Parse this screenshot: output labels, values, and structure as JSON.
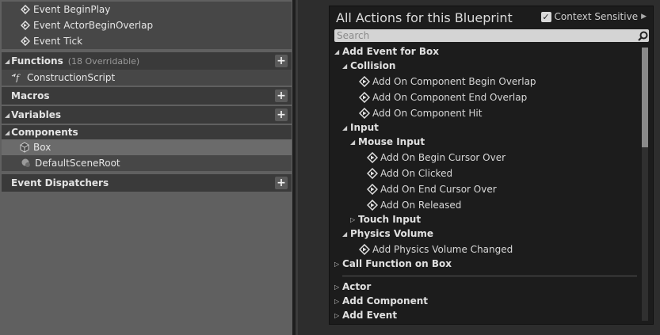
{
  "left_panel": {
    "events": [
      "Event BeginPlay",
      "Event ActorBeginOverlap",
      "Event Tick"
    ],
    "functions": {
      "label": "Functions",
      "count": "(18 Overridable)",
      "items": [
        "ConstructionScript"
      ]
    },
    "macros": {
      "label": "Macros"
    },
    "variables": {
      "label": "Variables"
    },
    "components": {
      "label": "Components",
      "items": [
        "Box",
        "DefaultSceneRoot"
      ]
    },
    "event_dispatchers": {
      "label": "Event Dispatchers"
    },
    "plus": "+"
  },
  "menu": {
    "title": "All Actions for this Blueprint",
    "context_sensitive": {
      "label": "Context Sensitive",
      "checked": true
    },
    "search": {
      "placeholder": "Search",
      "value": ""
    },
    "items": [
      {
        "label": "Add Event for Box",
        "kind": "category"
      },
      {
        "label": "Collision",
        "kind": "category"
      },
      {
        "label": "Add On Component Begin Overlap",
        "kind": "action"
      },
      {
        "label": "Add On Component End Overlap",
        "kind": "action"
      },
      {
        "label": "Add On Component Hit",
        "kind": "action"
      },
      {
        "label": "Input",
        "kind": "category"
      },
      {
        "label": "Mouse Input",
        "kind": "category"
      },
      {
        "label": "Add On Begin Cursor Over",
        "kind": "action"
      },
      {
        "label": "Add On Clicked",
        "kind": "action"
      },
      {
        "label": "Add On End Cursor Over",
        "kind": "action"
      },
      {
        "label": "Add On Released",
        "kind": "action"
      },
      {
        "label": "Touch Input",
        "kind": "category"
      },
      {
        "label": "Physics Volume",
        "kind": "category"
      },
      {
        "label": "Add Physics Volume Changed",
        "kind": "action"
      },
      {
        "label": "Call Function on Box",
        "kind": "category"
      },
      {
        "label": "Actor",
        "kind": "category"
      },
      {
        "label": "Add Component",
        "kind": "category"
      },
      {
        "label": "Add Event",
        "kind": "category"
      }
    ]
  },
  "colors": {
    "accent": "#d8d8d8",
    "panel": "#474747",
    "menu_bg": "#1c1c1c"
  }
}
